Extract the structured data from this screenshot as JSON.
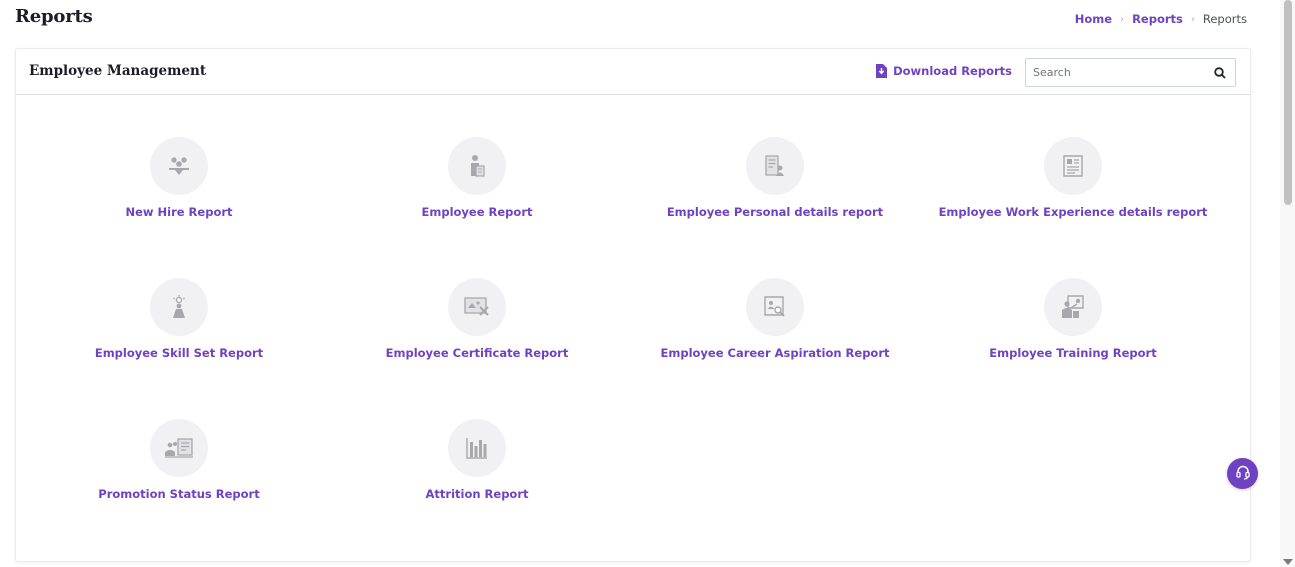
{
  "page": {
    "title": "Reports"
  },
  "breadcrumb": {
    "home": "Home",
    "reports": "Reports",
    "current": "Reports"
  },
  "card": {
    "title": "Employee Management",
    "download_label": "Download Reports",
    "search_placeholder": "Search"
  },
  "reports": [
    {
      "label": "New Hire Report",
      "icon": "new-hire-icon"
    },
    {
      "label": "Employee Report",
      "icon": "employee-icon"
    },
    {
      "label": "Employee Personal details report",
      "icon": "personal-details-icon"
    },
    {
      "label": "Employee Work Experience details report",
      "icon": "work-experience-icon"
    },
    {
      "label": "Employee Skill Set Report",
      "icon": "skill-set-icon"
    },
    {
      "label": "Employee Certificate Report",
      "icon": "certificate-icon"
    },
    {
      "label": "Employee Career Aspiration Report",
      "icon": "career-aspiration-icon"
    },
    {
      "label": "Employee Training Report",
      "icon": "training-icon"
    },
    {
      "label": "Promotion Status Report",
      "icon": "promotion-icon"
    },
    {
      "label": "Attrition Report",
      "icon": "attrition-icon"
    }
  ],
  "colors": {
    "accent": "#6f42c1",
    "icon_bg": "#f1f1f3",
    "icon_fg": "#a7a7ad"
  }
}
